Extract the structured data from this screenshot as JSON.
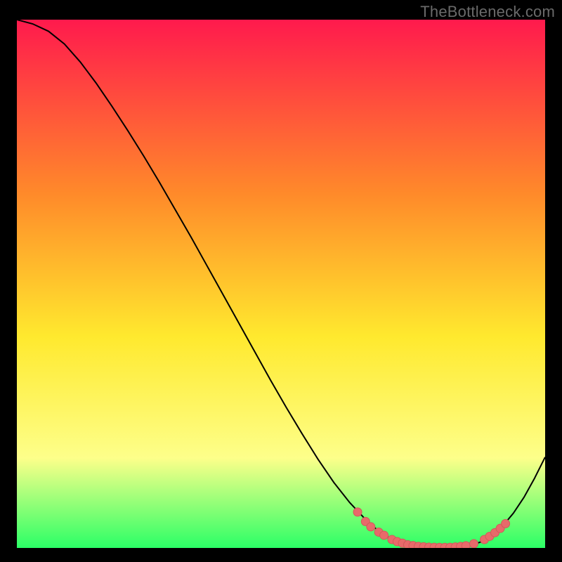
{
  "watermark": "TheBottleneck.com",
  "colors": {
    "frame": "#000000",
    "line": "#000000",
    "dot_fill": "#e86a6a",
    "dot_stroke": "#d15a5a",
    "grad_top": "#ff1a4d",
    "grad_mid1": "#ff8a2a",
    "grad_mid2": "#ffe92e",
    "grad_mid3": "#fdff8a",
    "grad_bottom": "#2bff66"
  },
  "chart_data": {
    "type": "line",
    "title": "",
    "xlabel": "",
    "ylabel": "",
    "xlim": [
      0,
      100
    ],
    "ylim": [
      0,
      100
    ],
    "series": [
      {
        "name": "bottleneck-curve",
        "x": [
          0,
          3,
          6,
          9,
          12,
          15,
          18,
          21,
          24,
          27,
          30,
          33,
          36,
          39,
          42,
          45,
          48,
          51,
          54,
          57,
          60,
          63,
          66,
          68,
          70,
          72,
          74,
          76,
          78,
          80,
          82,
          84,
          86,
          88,
          90,
          92,
          94,
          96,
          98,
          100
        ],
        "y": [
          100,
          99.2,
          97.8,
          95.4,
          92.0,
          88.0,
          83.6,
          79.0,
          74.2,
          69.2,
          64.0,
          58.8,
          53.4,
          48.0,
          42.6,
          37.2,
          31.8,
          26.6,
          21.6,
          16.8,
          12.4,
          8.6,
          5.4,
          3.6,
          2.2,
          1.2,
          0.6,
          0.3,
          0.15,
          0.1,
          0.1,
          0.2,
          0.5,
          1.2,
          2.4,
          4.2,
          6.6,
          9.6,
          13.2,
          17.2
        ]
      }
    ],
    "dots": {
      "name": "highlighted-points",
      "x": [
        64.5,
        66.0,
        67.0,
        68.5,
        69.5,
        71.0,
        72.0,
        73.0,
        74.0,
        75.0,
        76.0,
        77.0,
        78.0,
        79.0,
        80.0,
        81.0,
        82.0,
        83.0,
        84.0,
        85.0,
        86.5,
        88.5,
        89.5,
        90.5,
        91.5,
        92.5
      ],
      "y": [
        6.8,
        5.0,
        4.0,
        3.0,
        2.4,
        1.6,
        1.2,
        0.9,
        0.6,
        0.45,
        0.3,
        0.22,
        0.15,
        0.12,
        0.1,
        0.1,
        0.12,
        0.18,
        0.28,
        0.42,
        0.8,
        1.6,
        2.2,
        2.9,
        3.7,
        4.6
      ]
    }
  }
}
